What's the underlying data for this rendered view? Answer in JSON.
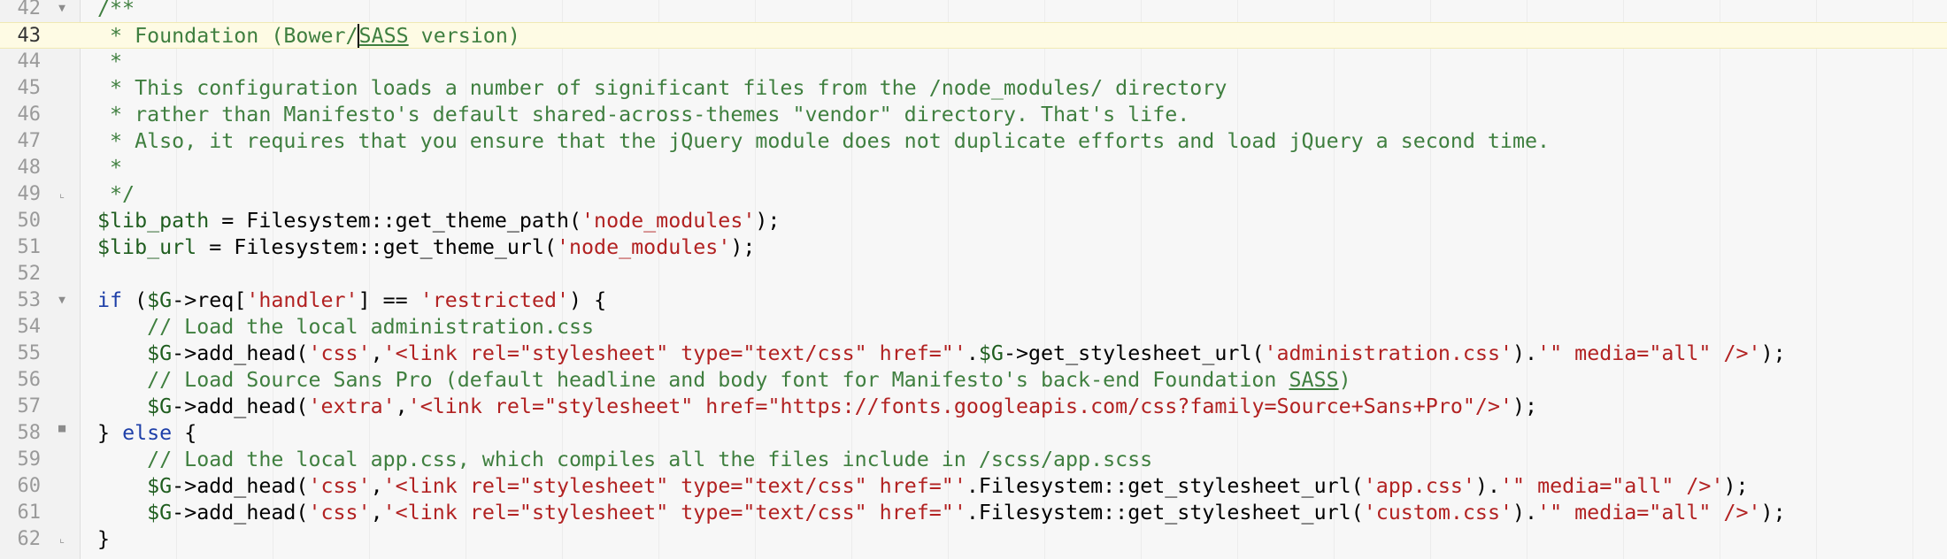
{
  "editor": {
    "current_line": 43,
    "lines": [
      {
        "num": "42",
        "fold": "▼",
        "segs": [
          {
            "t": "c",
            "x": "/**"
          }
        ]
      },
      {
        "num": "43",
        "fold": "",
        "segs": [
          {
            "t": "c",
            "x": " * Foundation (Bower/"
          },
          {
            "t": "c u caret",
            "x": "SASS"
          },
          {
            "t": "c",
            "x": " version)"
          }
        ]
      },
      {
        "num": "44",
        "fold": "",
        "segs": [
          {
            "t": "c",
            "x": " *"
          }
        ]
      },
      {
        "num": "45",
        "fold": "",
        "segs": [
          {
            "t": "c",
            "x": " * This configuration loads a number of significant files from the /node_modules/ directory"
          }
        ]
      },
      {
        "num": "46",
        "fold": "",
        "segs": [
          {
            "t": "c",
            "x": " * rather than Manifesto's default shared-across-themes \"vendor\" directory. That's life."
          }
        ]
      },
      {
        "num": "47",
        "fold": "",
        "segs": [
          {
            "t": "c",
            "x": " * Also, it requires that you ensure that the jQuery module does not duplicate efforts and load jQuery a second time."
          }
        ]
      },
      {
        "num": "48",
        "fold": "",
        "segs": [
          {
            "t": "c",
            "x": " *"
          }
        ]
      },
      {
        "num": "49",
        "fold": "⌞",
        "segs": [
          {
            "t": "c",
            "x": " */"
          }
        ]
      },
      {
        "num": "50",
        "fold": "",
        "segs": [
          {
            "t": "v",
            "x": "$lib_path"
          },
          {
            "t": "p",
            "x": " = Filesystem::get_theme_path("
          },
          {
            "t": "s",
            "x": "'node_modules'"
          },
          {
            "t": "p",
            "x": ");"
          }
        ]
      },
      {
        "num": "51",
        "fold": "",
        "segs": [
          {
            "t": "v",
            "x": "$lib_url"
          },
          {
            "t": "p",
            "x": " = Filesystem::get_theme_url("
          },
          {
            "t": "s",
            "x": "'node_modules'"
          },
          {
            "t": "p",
            "x": ");"
          }
        ]
      },
      {
        "num": "52",
        "fold": "",
        "segs": []
      },
      {
        "num": "53",
        "fold": "▼",
        "segs": [
          {
            "t": "k",
            "x": "if"
          },
          {
            "t": "p",
            "x": " ("
          },
          {
            "t": "v",
            "x": "$G"
          },
          {
            "t": "p",
            "x": "->req["
          },
          {
            "t": "s",
            "x": "'handler'"
          },
          {
            "t": "p",
            "x": "] == "
          },
          {
            "t": "s",
            "x": "'restricted'"
          },
          {
            "t": "p",
            "x": ") {"
          }
        ]
      },
      {
        "num": "54",
        "fold": "",
        "segs": [
          {
            "t": "c",
            "x": "    // Load the local administration.css"
          }
        ]
      },
      {
        "num": "55",
        "fold": "",
        "segs": [
          {
            "t": "p",
            "x": "    "
          },
          {
            "t": "v",
            "x": "$G"
          },
          {
            "t": "p",
            "x": "->add_head("
          },
          {
            "t": "s",
            "x": "'css'"
          },
          {
            "t": "p",
            "x": ","
          },
          {
            "t": "s",
            "x": "'<link rel=\"stylesheet\" type=\"text/css\" href=\"'"
          },
          {
            "t": "p",
            "x": "."
          },
          {
            "t": "v",
            "x": "$G"
          },
          {
            "t": "p",
            "x": "->get_stylesheet_url("
          },
          {
            "t": "s",
            "x": "'administration.css'"
          },
          {
            "t": "p",
            "x": ")."
          },
          {
            "t": "s",
            "x": "'\" media=\"all\" />'"
          },
          {
            "t": "p",
            "x": ");"
          }
        ]
      },
      {
        "num": "56",
        "fold": "",
        "segs": [
          {
            "t": "c",
            "x": "    // Load Source Sans Pro (default headline and body font for Manifesto's back-end Foundation "
          },
          {
            "t": "c u",
            "x": "SASS"
          },
          {
            "t": "c",
            "x": ")"
          }
        ]
      },
      {
        "num": "57",
        "fold": "",
        "segs": [
          {
            "t": "p",
            "x": "    "
          },
          {
            "t": "v",
            "x": "$G"
          },
          {
            "t": "p",
            "x": "->add_head("
          },
          {
            "t": "s",
            "x": "'extra'"
          },
          {
            "t": "p",
            "x": ","
          },
          {
            "t": "s",
            "x": "'<link rel=\"stylesheet\" href=\"https://fonts.googleapis.com/css?family=Source+Sans+Pro\"/>'"
          },
          {
            "t": "p",
            "x": ");"
          }
        ]
      },
      {
        "num": "58",
        "fold": "▀",
        "segs": [
          {
            "t": "p",
            "x": "} "
          },
          {
            "t": "k",
            "x": "else"
          },
          {
            "t": "p",
            "x": " {"
          }
        ]
      },
      {
        "num": "59",
        "fold": "",
        "segs": [
          {
            "t": "c",
            "x": "    // Load the local app.css, which compiles all the files include in /scss/app.scss"
          }
        ]
      },
      {
        "num": "60",
        "fold": "",
        "segs": [
          {
            "t": "p",
            "x": "    "
          },
          {
            "t": "v",
            "x": "$G"
          },
          {
            "t": "p",
            "x": "->add_head("
          },
          {
            "t": "s",
            "x": "'css'"
          },
          {
            "t": "p",
            "x": ","
          },
          {
            "t": "s",
            "x": "'<link rel=\"stylesheet\" type=\"text/css\" href=\"'"
          },
          {
            "t": "p",
            "x": ".Filesystem::get_stylesheet_url("
          },
          {
            "t": "s",
            "x": "'app.css'"
          },
          {
            "t": "p",
            "x": ")."
          },
          {
            "t": "s",
            "x": "'\" media=\"all\" />'"
          },
          {
            "t": "p",
            "x": ");"
          }
        ]
      },
      {
        "num": "61",
        "fold": "",
        "segs": [
          {
            "t": "p",
            "x": "    "
          },
          {
            "t": "v",
            "x": "$G"
          },
          {
            "t": "p",
            "x": "->add_head("
          },
          {
            "t": "s",
            "x": "'css'"
          },
          {
            "t": "p",
            "x": ","
          },
          {
            "t": "s",
            "x": "'<link rel=\"stylesheet\" type=\"text/css\" href=\"'"
          },
          {
            "t": "p",
            "x": ".Filesystem::get_stylesheet_url("
          },
          {
            "t": "s",
            "x": "'custom.css'"
          },
          {
            "t": "p",
            "x": ")."
          },
          {
            "t": "s",
            "x": "'\" media=\"all\" />'"
          },
          {
            "t": "p",
            "x": ");"
          }
        ]
      },
      {
        "num": "62",
        "fold": "⌞",
        "segs": [
          {
            "t": "p",
            "x": "}"
          }
        ]
      }
    ]
  }
}
